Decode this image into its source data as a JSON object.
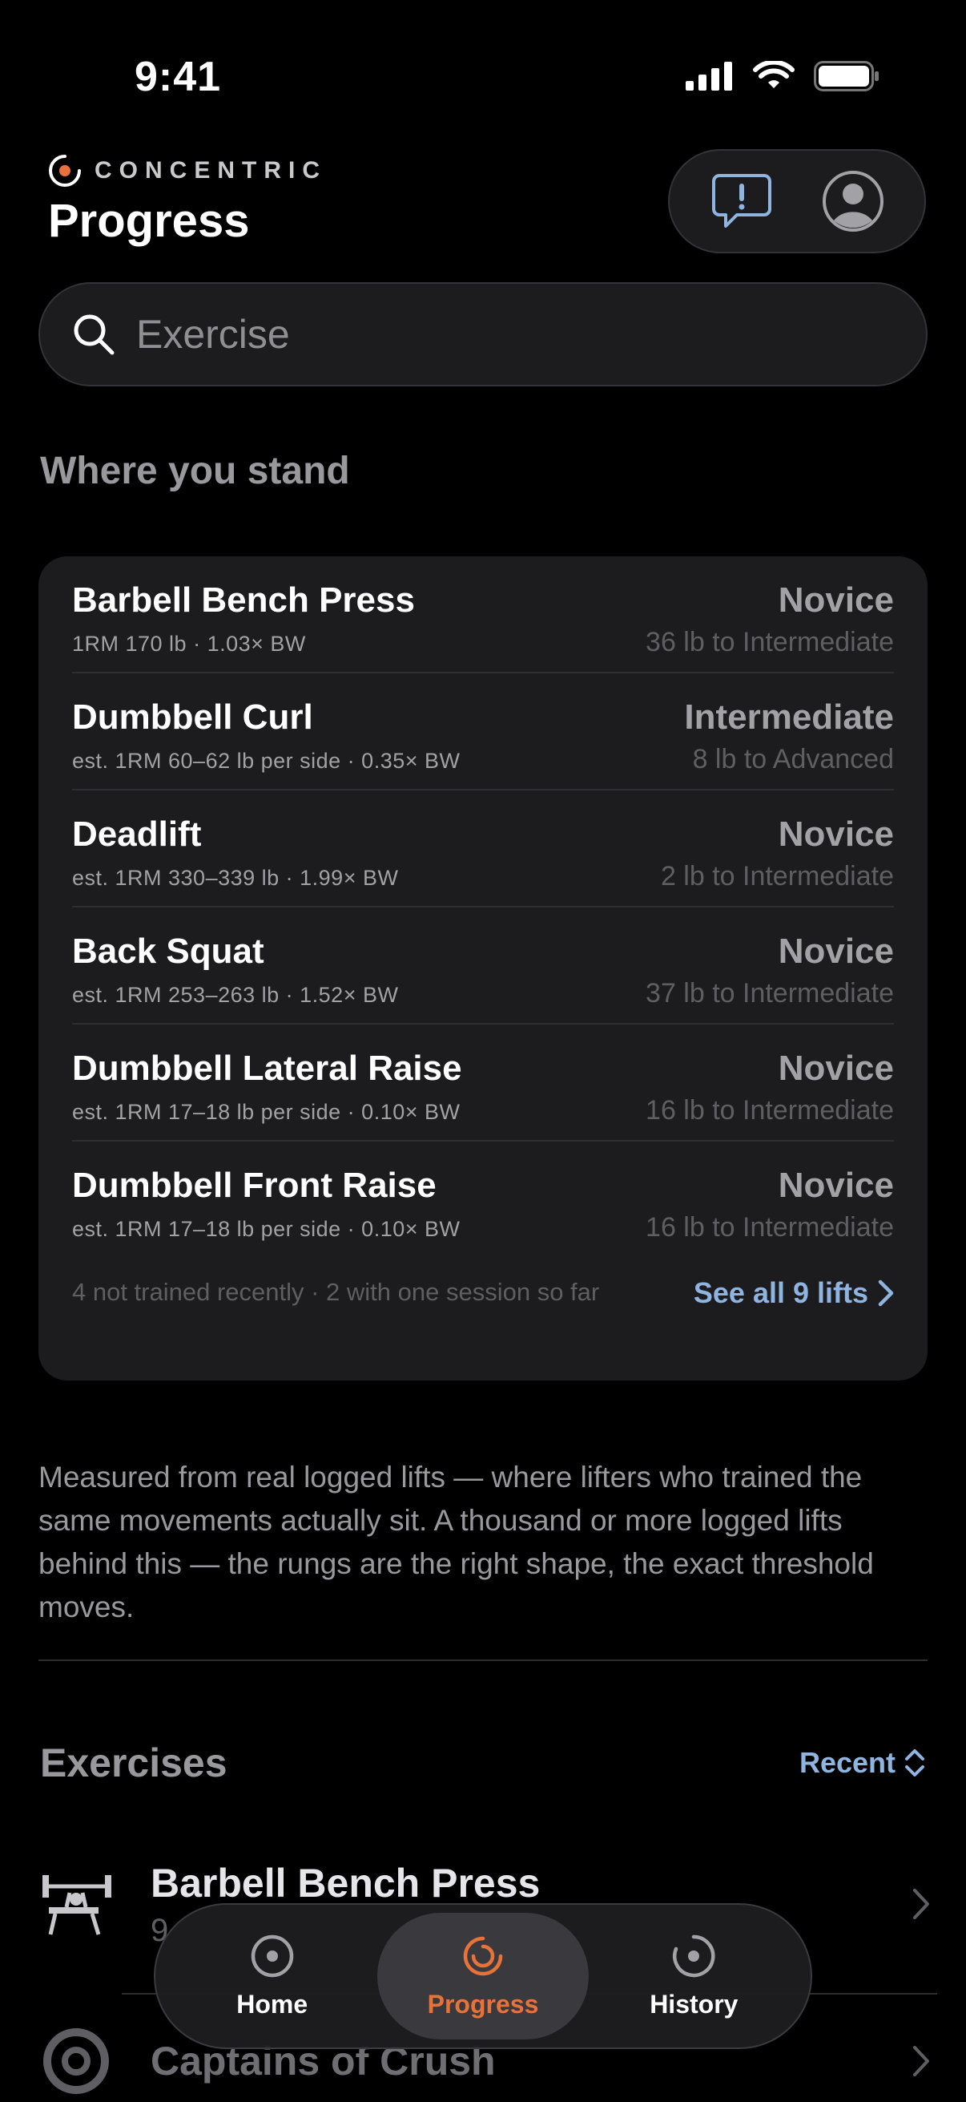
{
  "status": {
    "time": "9:41"
  },
  "header": {
    "brand": "CONCENTRIC",
    "title": "Progress",
    "accent": "#e8733a"
  },
  "search": {
    "placeholder": "Exercise"
  },
  "stand": {
    "title": "Where you stand",
    "lifts": [
      {
        "name": "Barbell Bench Press",
        "sub": "1RM 170 lb · 1.03× BW",
        "level": "Novice",
        "next": "36 lb to Intermediate"
      },
      {
        "name": "Dumbbell Curl",
        "sub": "est. 1RM 60–62 lb per side · 0.35× BW",
        "level": "Intermediate",
        "next": "8 lb to Advanced"
      },
      {
        "name": "Deadlift",
        "sub": "est. 1RM 330–339 lb · 1.99× BW",
        "level": "Novice",
        "next": "2 lb to Intermediate"
      },
      {
        "name": "Back Squat",
        "sub": "est. 1RM 253–263 lb · 1.52× BW",
        "level": "Novice",
        "next": "37 lb to Intermediate"
      },
      {
        "name": "Dumbbell Lateral Raise",
        "sub": "est. 1RM 17–18 lb per side · 0.10× BW",
        "level": "Novice",
        "next": "16 lb to Intermediate"
      },
      {
        "name": "Dumbbell Front Raise",
        "sub": "est. 1RM 17–18 lb per side · 0.10× BW",
        "level": "Novice",
        "next": "16 lb to Intermediate"
      }
    ],
    "footer_note": "4 not trained recently · 2 with one session so far",
    "see_all": "See all 9 lifts"
  },
  "explain": "Measured from real logged lifts — where lifters who trained the same movements actually sit. A thousand or more logged lifts behind this — the rungs are the right shape, the exact threshold moves.",
  "exercises": {
    "title": "Exercises",
    "sort_label": "Recent",
    "items": [
      {
        "name": "Barbell Bench Press",
        "sub": "9"
      },
      {
        "name": "Captains of Crush",
        "sub": ""
      }
    ]
  },
  "tabs": [
    {
      "label": "Home",
      "icon": "home-icon",
      "active": false
    },
    {
      "label": "Progress",
      "icon": "progress-icon",
      "active": true
    },
    {
      "label": "History",
      "icon": "history-icon",
      "active": false
    }
  ]
}
